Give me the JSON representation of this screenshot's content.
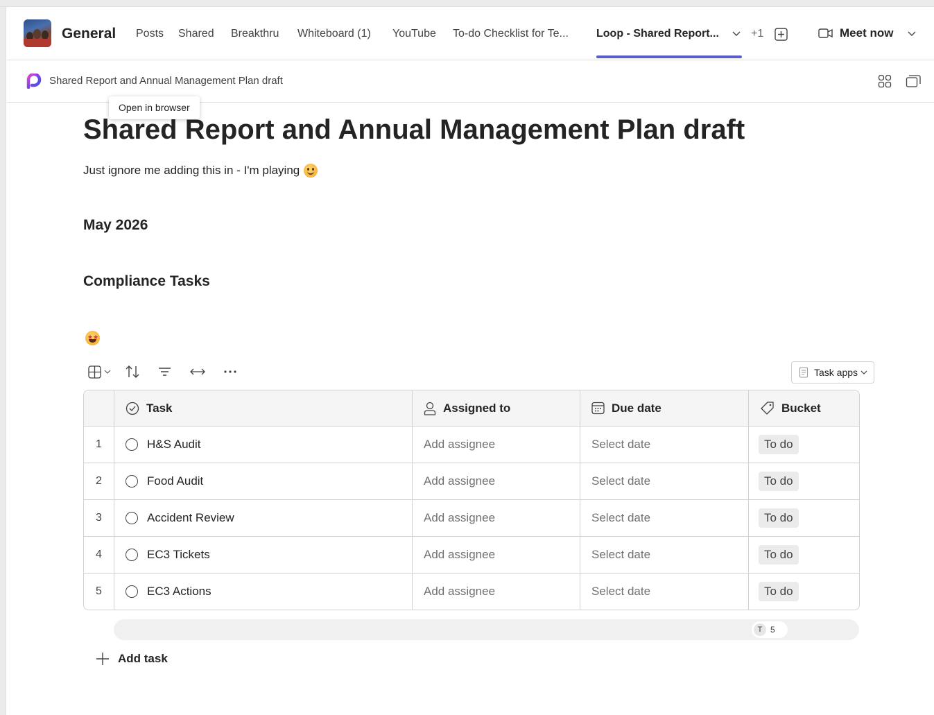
{
  "header": {
    "channel_name": "General",
    "tabs": [
      {
        "label": "Posts"
      },
      {
        "label": "Shared"
      },
      {
        "label": "Breakthru"
      },
      {
        "label": "Whiteboard (1)"
      },
      {
        "label": "YouTube"
      },
      {
        "label": "To-do Checklist for Te..."
      },
      {
        "label": "Loop - Shared Report..."
      }
    ],
    "more_tabs": "+1",
    "meet_now": "Meet now",
    "accent": "#5b5fc7"
  },
  "loop": {
    "doc_title": "Shared Report and Annual Management Plan draft",
    "tooltip": "Open in browser"
  },
  "page": {
    "title": "Shared Report and Annual Management Plan draft",
    "intro": "Just ignore me adding this in - I'm playing",
    "month": "May 2026",
    "section": "Compliance Tasks"
  },
  "toolbar": {
    "task_apps": "Task apps"
  },
  "table": {
    "columns": [
      "Task",
      "Assigned to",
      "Due date",
      "Bucket"
    ],
    "rows": [
      {
        "num": "1",
        "task": "H&S Audit",
        "assignee": "Add assignee",
        "due": "Select date",
        "bucket": "To do"
      },
      {
        "num": "2",
        "task": "Food Audit",
        "assignee": "Add assignee",
        "due": "Select date",
        "bucket": "To do"
      },
      {
        "num": "3",
        "task": "Accident Review",
        "assignee": "Add assignee",
        "due": "Select date",
        "bucket": "To do"
      },
      {
        "num": "4",
        "task": "EC3 Tickets",
        "assignee": "Add assignee",
        "due": "Select date",
        "bucket": "To do"
      },
      {
        "num": "5",
        "task": "EC3 Actions",
        "assignee": "Add assignee",
        "due": "Select date",
        "bucket": "To do"
      }
    ]
  },
  "presence": {
    "initial": "T",
    "count": "5"
  },
  "add_task": "Add task"
}
